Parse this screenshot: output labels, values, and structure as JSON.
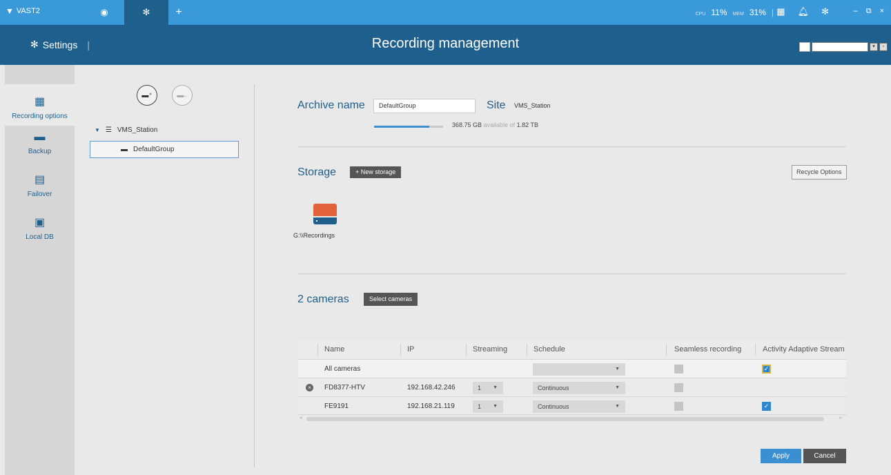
{
  "app": {
    "name": "VAST2",
    "tabs": [
      {
        "icon": "eye-icon",
        "label": "👁"
      },
      {
        "icon": "gear-icon",
        "label": "⚙"
      },
      {
        "icon": "plus-icon",
        "label": "+"
      }
    ],
    "cpu_label": "CPU",
    "cpu_value": "11%",
    "mem_label": "MEM",
    "mem_value": "31%",
    "separator": "|",
    "window_controls": {
      "minimize": "–",
      "restore": "⧉",
      "close": "×"
    }
  },
  "header": {
    "section": "Settings",
    "title": "Recording management"
  },
  "sidebar": {
    "items": [
      {
        "label": "Recording options",
        "icon": "calendar-icon",
        "active": true
      },
      {
        "label": "Backup",
        "icon": "backup-drive-icon",
        "active": false
      },
      {
        "label": "Failover",
        "icon": "failover-server-icon",
        "active": false
      },
      {
        "label": "Local DB",
        "icon": "local-db-icon",
        "active": false
      }
    ]
  },
  "tree": {
    "root": "VMS_Station",
    "child": "DefaultGroup"
  },
  "archive": {
    "name_label": "Archive name",
    "name_value": "DefaultGroup",
    "site_label": "Site",
    "site_value": "VMS_Station",
    "available": "368.75 GB",
    "available_text": "available of",
    "total": "1.82 TB",
    "used_fraction": 0.8
  },
  "storage": {
    "label": "Storage",
    "new_button": "+ New storage",
    "recycle_button": "Recycle Options",
    "path": "G:\\\\Recordings"
  },
  "cameras": {
    "label": "2 cameras",
    "select_button": "Select cameras",
    "columns": [
      "Name",
      "IP",
      "Streaming",
      "Schedule",
      "Seamless recording",
      "Activity Adaptive Stream"
    ],
    "all_label": "All cameras",
    "rows": [
      {
        "name": "FD8377-HTV",
        "ip": "192.168.42.246",
        "stream": "1",
        "schedule": "Continuous",
        "seamless": false,
        "adaptive": false
      },
      {
        "name": "FE9191",
        "ip": "192.168.21.119",
        "stream": "1",
        "schedule": "Continuous",
        "seamless": false,
        "adaptive": true
      }
    ]
  },
  "actions": {
    "apply": "Apply",
    "cancel": "Cancel"
  }
}
